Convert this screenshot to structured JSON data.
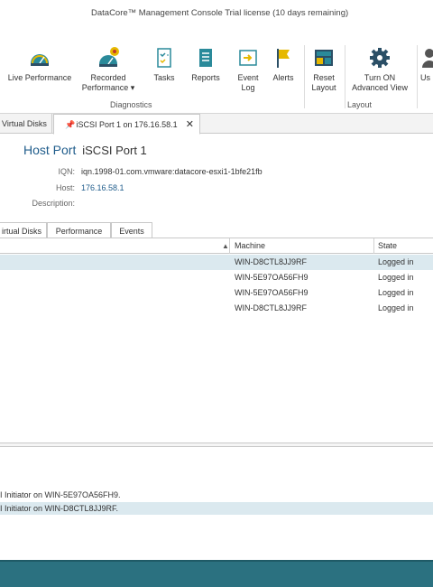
{
  "window": {
    "title": "DataCore™ Management Console   Trial license (10 days remaining)"
  },
  "ribbon": {
    "buttons": [
      {
        "label": "Live Performance",
        "icon": "gauge-icon"
      },
      {
        "label": "Recorded",
        "label2": "Performance ▾",
        "icon": "recorded-gauge-icon"
      },
      {
        "label": "Tasks",
        "icon": "tasks-icon"
      },
      {
        "label": "Reports",
        "icon": "reports-icon"
      },
      {
        "label": "Event",
        "label2": "Log",
        "icon": "event-log-icon"
      },
      {
        "label": "Alerts",
        "icon": "flag-icon"
      },
      {
        "label": "Reset",
        "label2": "Layout",
        "icon": "reset-layout-icon"
      },
      {
        "label": "Turn ON",
        "label2": "Advanced View",
        "icon": "gear-icon"
      },
      {
        "label": "Us",
        "icon": "user-icon"
      }
    ],
    "groups": {
      "diagnostics": "Diagnostics",
      "layout": "Layout"
    }
  },
  "tabs": [
    {
      "label": "Virtual Disks"
    },
    {
      "label": "iSCSI Port 1 on 176.16.58.1"
    }
  ],
  "header": {
    "kind": "Host Port",
    "name": "iSCSI Port 1"
  },
  "properties": {
    "iqn_label": "IQN:",
    "iqn_value": "iqn.1998-01.com.vmware:datacore-esxi1-1bfe21fb",
    "host_label": "Host:",
    "host_value": "176.16.58.1",
    "desc_label": "Description:",
    "desc_value": ""
  },
  "subtabs": [
    {
      "label": "irtual Disks"
    },
    {
      "label": "Performance"
    },
    {
      "label": "Events"
    }
  ],
  "grid": {
    "columns": {
      "col1": "",
      "machine": "Machine",
      "state": "State"
    },
    "rows": [
      {
        "machine": "WIN-D8CTL8JJ9RF",
        "state": "Logged in"
      },
      {
        "machine": "WIN-5E97OA56FH9",
        "state": "Logged in"
      },
      {
        "machine": "WIN-5E97OA56FH9",
        "state": "Logged in"
      },
      {
        "machine": "WIN-D8CTL8JJ9RF",
        "state": "Logged in"
      }
    ]
  },
  "log": [
    {
      "text": "I Initiator on WIN-5E97OA56FH9."
    },
    {
      "text": "I Initiator on WIN-D8CTL8JJ9RF."
    }
  ],
  "colors": {
    "accent": "#1f5c8b",
    "statusbar": "#2b7180",
    "selection": "#dbe9ef"
  }
}
